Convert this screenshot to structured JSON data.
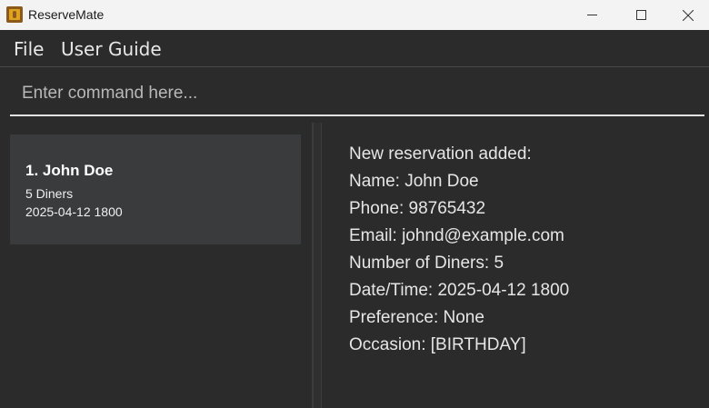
{
  "window": {
    "title": "ReserveMate"
  },
  "menu": {
    "file": "File",
    "user_guide": "User Guide"
  },
  "command": {
    "placeholder": "Enter command here..."
  },
  "reservations": [
    {
      "index_name": "1. John Doe",
      "diners": "5 Diners",
      "datetime": "2025-04-12 1800"
    }
  ],
  "result": {
    "lines": [
      "New reservation added:",
      "Name: John Doe",
      "Phone: 98765432",
      "Email: johnd@example.com",
      "Number of Diners: 5",
      "Date/Time: 2025-04-12 1800",
      "Preference: None",
      "Occasion: [BIRTHDAY]"
    ]
  }
}
